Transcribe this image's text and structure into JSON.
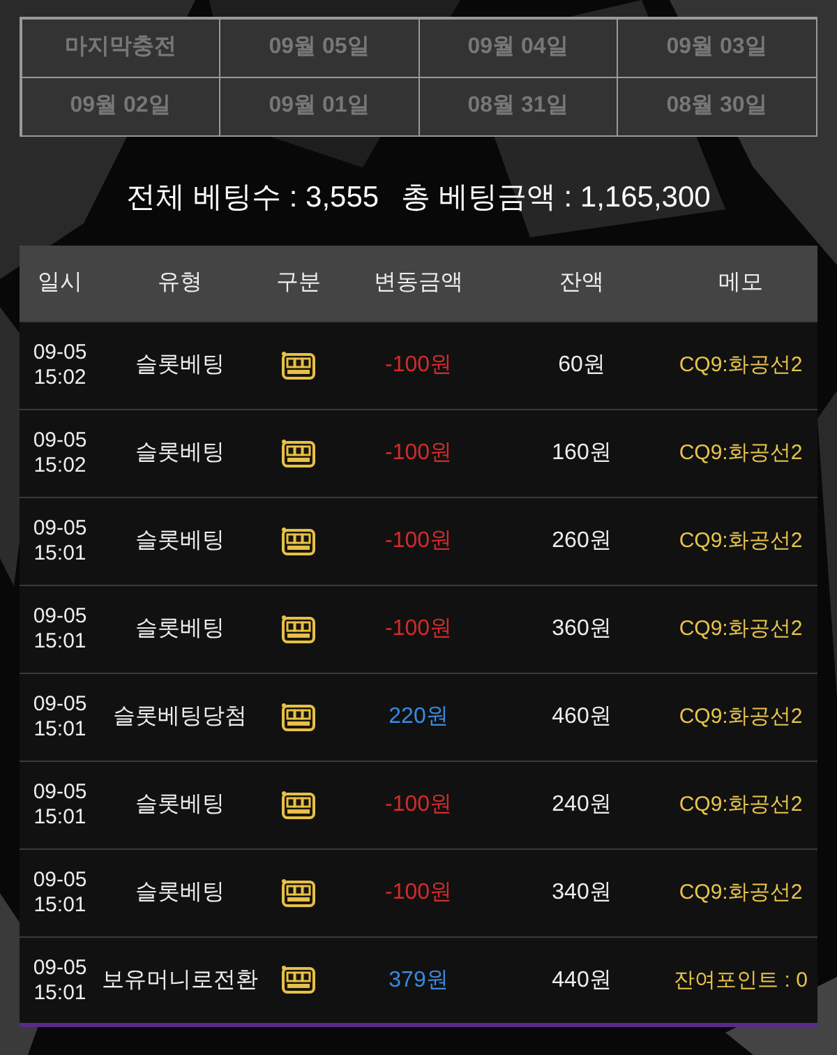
{
  "date_tabs": [
    {
      "label": "마지막충전"
    },
    {
      "label": "09월 05일"
    },
    {
      "label": "09월 04일"
    },
    {
      "label": "09월 03일"
    },
    {
      "label": "09월 02일"
    },
    {
      "label": "09월 01일"
    },
    {
      "label": "08월 31일"
    },
    {
      "label": "08월 30일"
    }
  ],
  "summary": {
    "total_bets": "전체 베팅수 : 3,555",
    "total_amount": "총 베팅금액 : 1,165,300"
  },
  "table": {
    "columns": [
      "일시",
      "유형",
      "구분",
      "변동금액",
      "잔액",
      "메모"
    ],
    "rows": [
      {
        "date": "09-05",
        "time": "15:02",
        "type": "슬롯베팅",
        "amount": "-100원",
        "kind": "debit",
        "balance": "60원",
        "memo": "CQ9:화공선2"
      },
      {
        "date": "09-05",
        "time": "15:02",
        "type": "슬롯베팅",
        "amount": "-100원",
        "kind": "debit",
        "balance": "160원",
        "memo": "CQ9:화공선2"
      },
      {
        "date": "09-05",
        "time": "15:01",
        "type": "슬롯베팅",
        "amount": "-100원",
        "kind": "debit",
        "balance": "260원",
        "memo": "CQ9:화공선2"
      },
      {
        "date": "09-05",
        "time": "15:01",
        "type": "슬롯베팅",
        "amount": "-100원",
        "kind": "debit",
        "balance": "360원",
        "memo": "CQ9:화공선2"
      },
      {
        "date": "09-05",
        "time": "15:01",
        "type": "슬롯베팅당첨",
        "amount": "220원",
        "kind": "credit",
        "balance": "460원",
        "memo": "CQ9:화공선2"
      },
      {
        "date": "09-05",
        "time": "15:01",
        "type": "슬롯베팅",
        "amount": "-100원",
        "kind": "debit",
        "balance": "240원",
        "memo": "CQ9:화공선2"
      },
      {
        "date": "09-05",
        "time": "15:01",
        "type": "슬롯베팅",
        "amount": "-100원",
        "kind": "debit",
        "balance": "340원",
        "memo": "CQ9:화공선2"
      },
      {
        "date": "09-05",
        "time": "15:01",
        "type": "보유머니로전환",
        "amount": "379원",
        "kind": "credit",
        "balance": "440원",
        "memo": "잔여포인트 : 0"
      }
    ]
  }
}
